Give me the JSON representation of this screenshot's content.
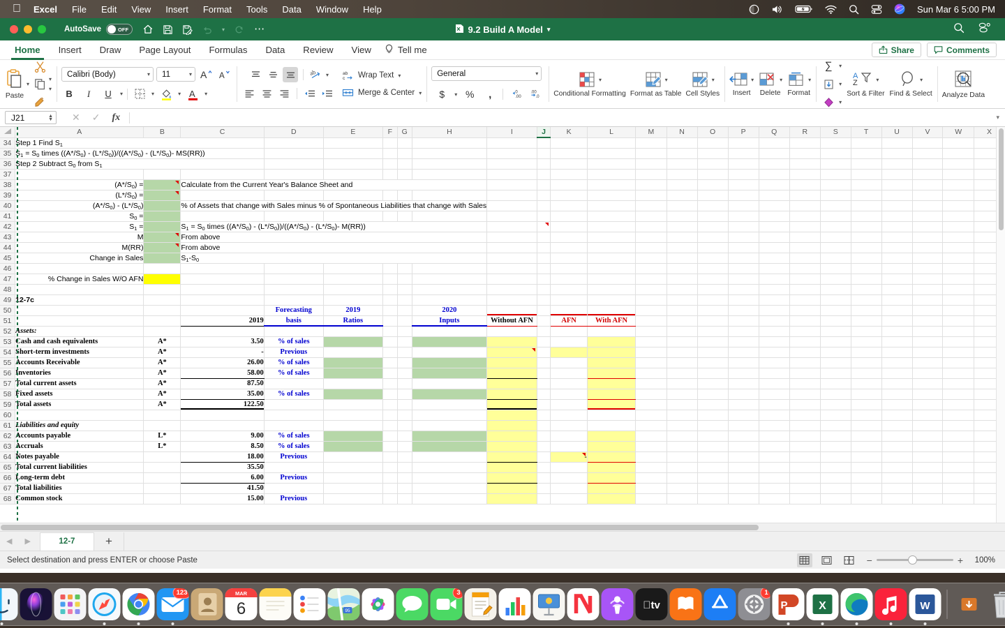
{
  "macbar": {
    "apple_icon": "apple-icon",
    "items": [
      {
        "label": "Excel",
        "bold": true
      },
      {
        "label": "File"
      },
      {
        "label": "Edit"
      },
      {
        "label": "View"
      },
      {
        "label": "Insert"
      },
      {
        "label": "Format"
      },
      {
        "label": "Tools"
      },
      {
        "label": "Data"
      },
      {
        "label": "Window"
      },
      {
        "label": "Help"
      }
    ],
    "status_icons": [
      "dark-mode-icon",
      "volume-icon",
      "battery-charging-icon",
      "wifi-icon",
      "spotlight-search-icon",
      "control-center-icon",
      "siri-icon"
    ],
    "clock": "Sun Mar 6  5:00 PM"
  },
  "titlebar": {
    "autosave_label": "AutoSave",
    "autosave_state": "OFF",
    "quick_icons": [
      "home-icon",
      "save-icon",
      "save-as-icon",
      "undo-icon",
      "chevron-down-icon",
      "redo-icon",
      "more-icon"
    ],
    "document_title": "9.2 Build A Model",
    "document_icon": "excel-file-icon",
    "title_chevron": "chevron-down-icon",
    "right_icons": [
      "search-icon",
      "ribbon-options-icon"
    ]
  },
  "ribbon": {
    "tabs": [
      {
        "label": "Home",
        "active": true
      },
      {
        "label": "Insert",
        "active": false
      },
      {
        "label": "Draw",
        "active": false
      },
      {
        "label": "Page Layout",
        "active": false
      },
      {
        "label": "Formulas",
        "active": false
      },
      {
        "label": "Data",
        "active": false
      },
      {
        "label": "Review",
        "active": false
      },
      {
        "label": "View",
        "active": false
      }
    ],
    "tell_me": "Tell me",
    "tell_me_icon": "lightbulb-icon",
    "share_label": "Share",
    "comments_label": "Comments",
    "clipboard": {
      "paste_label": "Paste",
      "cut_icon": "scissors-icon",
      "copy_icon": "copy-icon",
      "format_painter_icon": "paintbrush-icon"
    },
    "font": {
      "name": "Calibri (Body)",
      "size": "11",
      "grow_label": "A",
      "shrink_label": "A",
      "bold": "B",
      "italic": "I",
      "underline": "U",
      "borders_icon": "borders-icon",
      "fill_icon": "fill-color-icon",
      "font_color_icon": "font-color-icon"
    },
    "alignment": {
      "wrap_text": "Wrap Text",
      "merge_center": "Merge & Center",
      "orientation_icon": "text-orientation-icon",
      "indent_decrease_icon": "decrease-indent-icon",
      "indent_increase_icon": "increase-indent-icon"
    },
    "number": {
      "format": "General",
      "currency": "$",
      "percent": "%",
      "comma": ",",
      "dec_decrease": ".00",
      "dec_increase": ".0"
    },
    "styles": [
      {
        "label": "Conditional Formatting",
        "icon": "conditional-formatting-icon"
      },
      {
        "label": "Format as Table",
        "icon": "format-as-table-icon"
      },
      {
        "label": "Cell Styles",
        "icon": "cell-styles-icon"
      }
    ],
    "cells": [
      {
        "label": "Insert",
        "icon": "insert-cells-icon"
      },
      {
        "label": "Delete",
        "icon": "delete-cells-icon"
      },
      {
        "label": "Format",
        "icon": "format-cells-icon"
      }
    ],
    "editing": [
      {
        "label": "Sort & Filter",
        "icon": "sort-filter-icon"
      },
      {
        "label": "Find & Select",
        "icon": "find-select-icon"
      }
    ],
    "autosum_icon": "autosum-icon",
    "fill_down_icon": "fill-down-icon",
    "clear_icon": "clear-icon",
    "analyze": {
      "label": "Analyze Data",
      "icon": "analyze-data-icon"
    }
  },
  "formula_bar": {
    "name_box": "J21",
    "cancel_icon": "cancel-icon",
    "enter_icon": "confirm-icon",
    "fx_icon": "function-icon",
    "formula_value": "",
    "collapse_icon": "chevron-down-icon"
  },
  "grid": {
    "columns": [
      "A",
      "B",
      "C",
      "D",
      "E",
      "F",
      "G",
      "H",
      "I",
      "J",
      "K",
      "L",
      "M",
      "N",
      "O",
      "P",
      "Q",
      "R",
      "S",
      "T",
      "U",
      "V",
      "W",
      "X"
    ],
    "active_column": "J",
    "first_row": 34,
    "last_row": 68,
    "rows": [
      {
        "n": 34,
        "A": "Step 1 Find S₁"
      },
      {
        "n": 35,
        "A": "S₁ = S₀ times ((A*/S₀) - (L*/S₀))/((A*/S₀) - (L*/S₀)- MS(RR))"
      },
      {
        "n": 36,
        "A": "Step 2 Subtract S₀ from S₁"
      },
      {
        "n": 37
      },
      {
        "n": 38,
        "A": "(A*/S₀) =",
        "B": "",
        "C": "Calculate from the Current Year's  Balance Sheet and"
      },
      {
        "n": 39,
        "A": "(L*/S₀) =",
        "B": ""
      },
      {
        "n": 40,
        "A": "(A*/S₀) - (L*/S₀)",
        "B": "",
        "C": "%  of Assets that change with Sales minus % of Spontaneous Liabilities that change with Sales"
      },
      {
        "n": 41,
        "A": "S₀ =",
        "B": ""
      },
      {
        "n": 42,
        "A": "S₁ =",
        "B": "",
        "C": "S₁ = S₀ times ((A*/S₀) - (L*/S₀))/((A*/S₀) - (L*/S₀)- M(RR))"
      },
      {
        "n": 43,
        "A": "M",
        "B": "",
        "C": "From above"
      },
      {
        "n": 44,
        "A": "M(RR)",
        "B": "",
        "C": "From above"
      },
      {
        "n": 45,
        "A": "Change in Sales",
        "B": "",
        "C": "S₁-S₀"
      },
      {
        "n": 46
      },
      {
        "n": 47,
        "A": "% Change in Sales W/O AFN",
        "B": ""
      },
      {
        "n": 48
      },
      {
        "n": 49,
        "A": "12-7c"
      },
      {
        "n": 50,
        "D": "Forecasting",
        "E": "2019",
        "H": "2020"
      },
      {
        "n": 51,
        "C": "2019",
        "D": "basis",
        "E": "Ratios",
        "H": "Inputs",
        "I": "Without AFN",
        "K": "AFN",
        "L": "With AFN"
      },
      {
        "n": 52,
        "A": "Assets:"
      },
      {
        "n": 53,
        "A": "Cash and cash equivalents",
        "B": "A*",
        "C": "3.50",
        "D": "% of sales"
      },
      {
        "n": 54,
        "A": "Short-term investments",
        "B": "A*",
        "C": "-",
        "D": "Previous"
      },
      {
        "n": 55,
        "A": "Accounts Receivable",
        "B": "A*",
        "C": "26.00",
        "D": "% of sales"
      },
      {
        "n": 56,
        "A": "Inventories",
        "B": "A*",
        "C": "58.00",
        "D": "% of sales"
      },
      {
        "n": 57,
        "A": "  Total current assets",
        "B": "A*",
        "C": "87.50"
      },
      {
        "n": 58,
        "A": "  Fixed assets",
        "B": "A*",
        "C": "35.00",
        "D": "% of sales"
      },
      {
        "n": 59,
        "A": "Total assets",
        "B": "A*",
        "C": "122.50"
      },
      {
        "n": 60
      },
      {
        "n": 61,
        "A": "Liabilities and equity"
      },
      {
        "n": 62,
        "A": "Accounts payable",
        "B": "L*",
        "C": "9.00",
        "D": "% of sales"
      },
      {
        "n": 63,
        "A": "Accruals",
        "B": "L*",
        "C": "8.50",
        "D": "% of sales"
      },
      {
        "n": 64,
        "A": "Notes payable",
        "C": "18.00",
        "D": "Previous"
      },
      {
        "n": 65,
        "A": "  Total current liabilities",
        "C": "35.50"
      },
      {
        "n": 66,
        "A": "Long-term debt",
        "C": "6.00",
        "D": "Previous"
      },
      {
        "n": 67,
        "A": "  Total liabilities",
        "C": "41.50"
      },
      {
        "n": 68,
        "A": "Common stock",
        "C": "15.00",
        "D": "Previous"
      }
    ]
  },
  "sheet_tabs": {
    "prev_icon": "left-arrow-icon",
    "next_icon": "right-arrow-icon",
    "tabs": [
      {
        "label": "12-7",
        "active": true
      }
    ],
    "add_label": "+"
  },
  "status_bar": {
    "message": "Select destination and press ENTER or choose Paste",
    "views": [
      "normal-view-icon",
      "page-layout-view-icon",
      "page-break-view-icon"
    ],
    "zoom_out": "−",
    "zoom_in": "+",
    "zoom_level": "100%"
  },
  "dock": {
    "items": [
      {
        "name": "finder",
        "badge": null,
        "running": true
      },
      {
        "name": "siri",
        "badge": null,
        "running": false
      },
      {
        "name": "launchpad",
        "badge": null,
        "running": false
      },
      {
        "name": "safari",
        "badge": null,
        "running": true
      },
      {
        "name": "chrome",
        "badge": null,
        "running": true
      },
      {
        "name": "mail",
        "badge": "123",
        "running": true
      },
      {
        "name": "contacts",
        "badge": null,
        "running": false
      },
      {
        "name": "calendar",
        "badge": null,
        "running": false,
        "month": "MAR",
        "day": "6"
      },
      {
        "name": "notes",
        "badge": null,
        "running": false
      },
      {
        "name": "reminders",
        "badge": null,
        "running": false
      },
      {
        "name": "maps",
        "badge": null,
        "running": false
      },
      {
        "name": "photos",
        "badge": null,
        "running": false
      },
      {
        "name": "messages",
        "badge": null,
        "running": false
      },
      {
        "name": "facetime",
        "badge": "3",
        "running": false
      },
      {
        "name": "pages",
        "badge": null,
        "running": false
      },
      {
        "name": "numbers",
        "badge": null,
        "running": false
      },
      {
        "name": "keynote",
        "badge": null,
        "running": false
      },
      {
        "name": "news",
        "badge": null,
        "running": false
      },
      {
        "name": "podcasts",
        "badge": null,
        "running": false
      },
      {
        "name": "appletv",
        "badge": null,
        "running": false
      },
      {
        "name": "books",
        "badge": null,
        "running": false
      },
      {
        "name": "appstore",
        "badge": null,
        "running": false
      },
      {
        "name": "settings",
        "badge": "1",
        "running": false
      },
      {
        "name": "powerpoint",
        "badge": null,
        "running": true
      },
      {
        "name": "excel",
        "badge": null,
        "running": true
      },
      {
        "name": "edge",
        "badge": null,
        "running": true
      },
      {
        "name": "music",
        "badge": null,
        "running": true
      },
      {
        "name": "word",
        "badge": null,
        "running": true
      },
      {
        "name": "downloads",
        "badge": null,
        "running": false
      },
      {
        "name": "trash",
        "badge": null,
        "running": false
      }
    ]
  },
  "colors": {
    "excel_green": "#1e7145",
    "green_fill": "#b6d7a8",
    "yellow_fill": "#ffff00",
    "light_yellow_fill": "#ffff99",
    "blue_text": "#0000d0",
    "red_text": "#d00000"
  }
}
